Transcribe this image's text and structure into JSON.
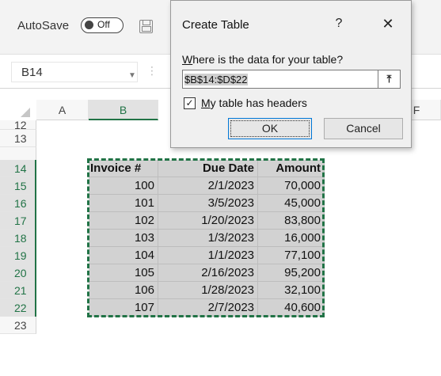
{
  "ribbon": {
    "autosave_label": "AutoSave",
    "autosave_state": "Off"
  },
  "formula_bar": {
    "name_box": "B14"
  },
  "columns": [
    {
      "label": "A"
    },
    {
      "label": "B"
    },
    {
      "label": "F"
    }
  ],
  "rows": [
    "12",
    "13",
    "14",
    "15",
    "16",
    "17",
    "18",
    "19",
    "20",
    "21",
    "22",
    "23"
  ],
  "table": {
    "headers": [
      "Invoice #",
      "Due Date",
      "Amount"
    ],
    "rows": [
      [
        "100",
        "2/1/2023",
        "70,000"
      ],
      [
        "101",
        "3/5/2023",
        "45,000"
      ],
      [
        "102",
        "1/20/2023",
        "83,800"
      ],
      [
        "103",
        "1/3/2023",
        "16,000"
      ],
      [
        "104",
        "1/1/2023",
        "77,100"
      ],
      [
        "105",
        "2/16/2023",
        "95,200"
      ],
      [
        "106",
        "1/28/2023",
        "32,100"
      ],
      [
        "107",
        "2/7/2023",
        "40,600"
      ]
    ]
  },
  "dialog": {
    "title": "Create Table",
    "help": "?",
    "close": "✕",
    "prompt": "Where is the data for your table?",
    "range_value": "$B$14:$D$22",
    "collapse_icon": "⤒",
    "has_headers_label": "My table has headers",
    "has_headers_checked": true,
    "check_mark": "✓",
    "ok_label": "OK",
    "cancel_label": "Cancel"
  },
  "colors": {
    "accent": "#217346",
    "selection": "#d2d2d2"
  }
}
